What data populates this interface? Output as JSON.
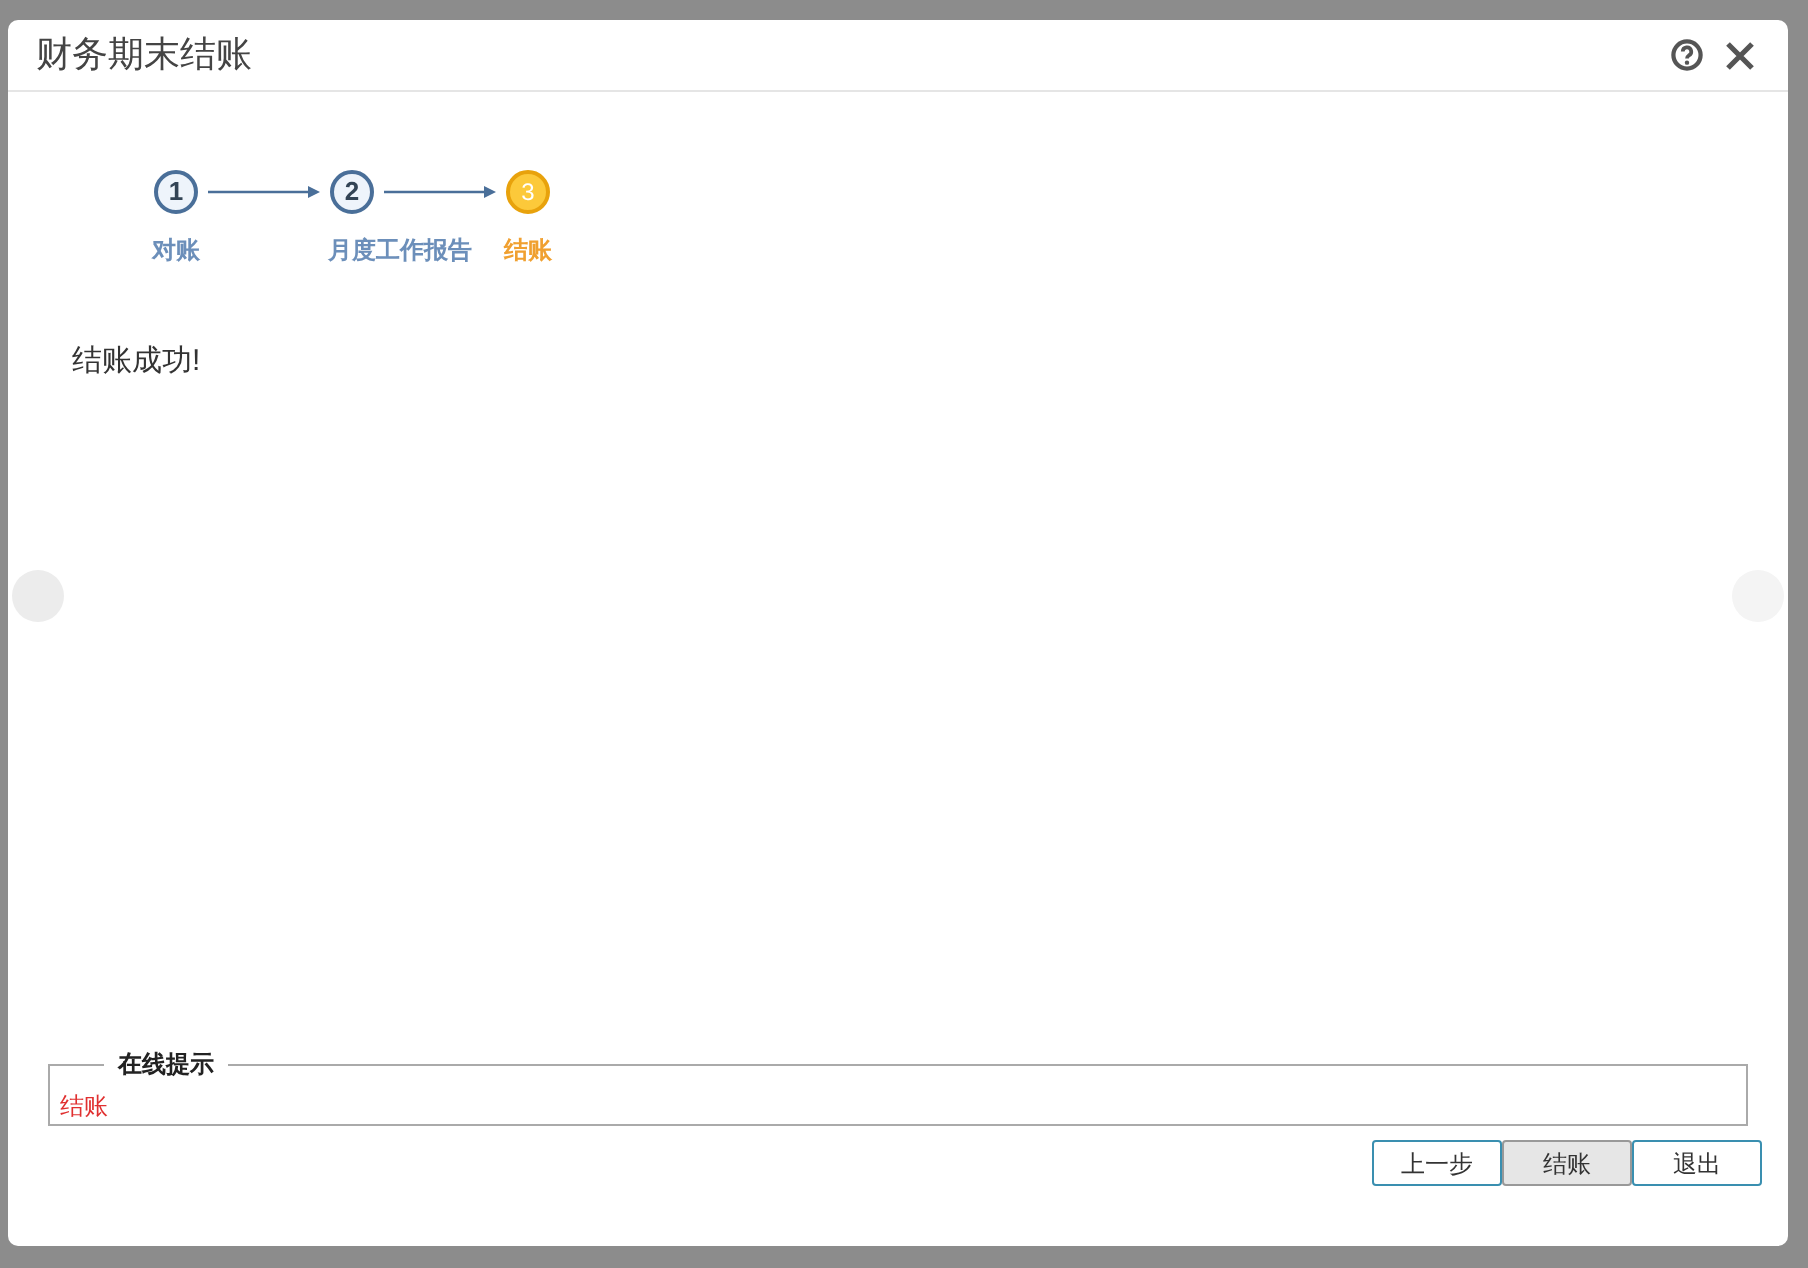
{
  "dialog": {
    "title": "财务期末结账"
  },
  "steps": [
    {
      "number": "1",
      "label": "对账",
      "selected": false
    },
    {
      "number": "2",
      "label": "月度工作报告",
      "selected": false
    },
    {
      "number": "3",
      "label": "结账",
      "selected": true
    }
  ],
  "message": "结账成功!",
  "tips": {
    "legend": "在线提示",
    "text": "结账"
  },
  "buttons": [
    {
      "label": "上一步",
      "disabled": false
    },
    {
      "label": "结账",
      "disabled": true
    },
    {
      "label": "退出",
      "disabled": false
    }
  ]
}
